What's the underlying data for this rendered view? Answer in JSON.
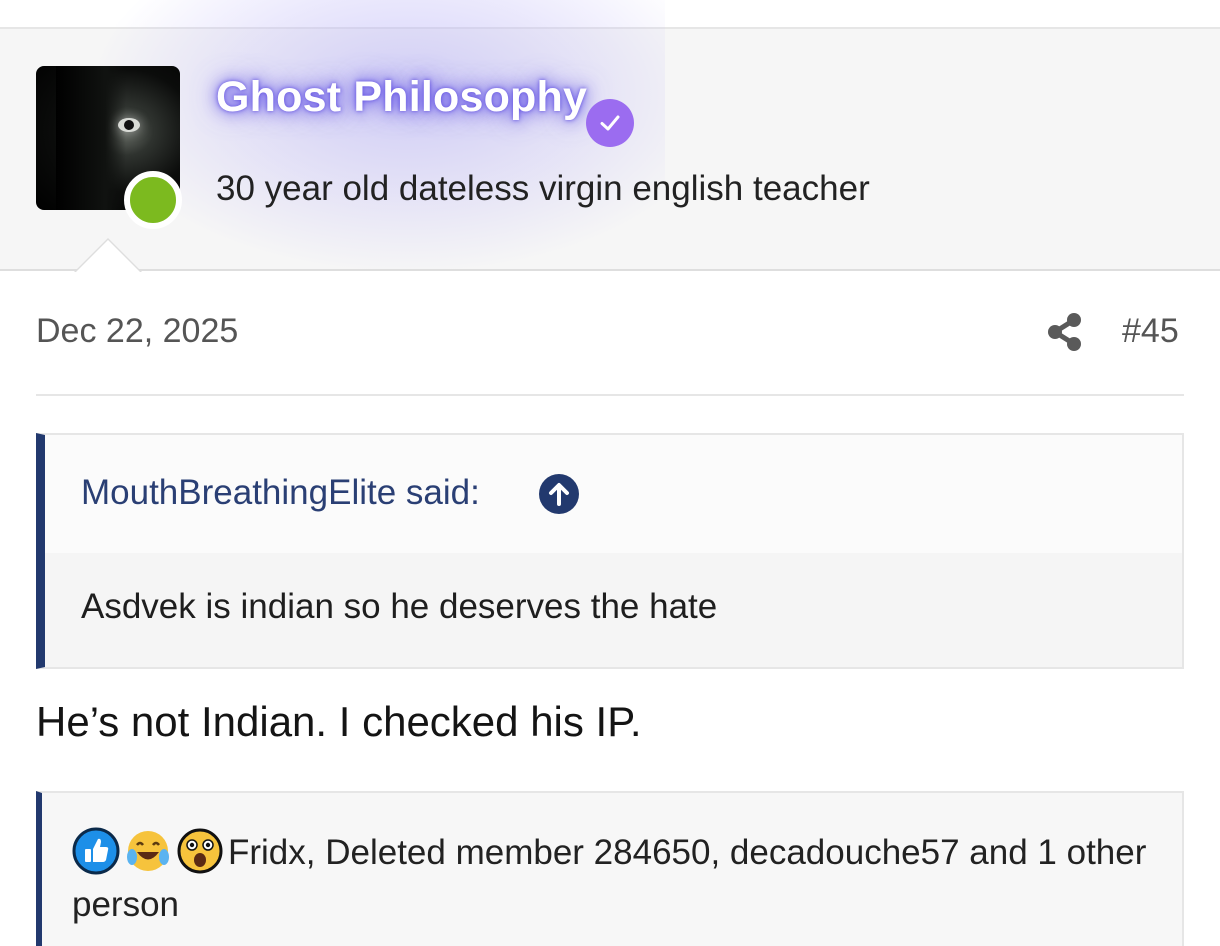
{
  "user": {
    "name": "Ghost Philosophy",
    "title": "30 year old dateless virgin english teacher",
    "verified_icon": "verified-check-icon",
    "online_status_color": "#7cba1f"
  },
  "post": {
    "date": "Dec 22, 2025",
    "number": "#45",
    "share_icon": "share-icon",
    "text": "He’s not Indian. I checked his IP."
  },
  "quote": {
    "author_line": "MouthBreathingElite said:",
    "jump_icon": "arrow-up-circle-icon",
    "text": "Asdvek is indian so he deserves the hate"
  },
  "reactions": {
    "icons": [
      "like-icon",
      "laughing-crying-icon",
      "wow-icon"
    ],
    "summary": "Fridx, Deleted member 284650, decadouche57 and 1 other person"
  },
  "colors": {
    "accent": "#22396e",
    "verified": "#9b6cf0",
    "username_glow": "#5f50e6"
  }
}
